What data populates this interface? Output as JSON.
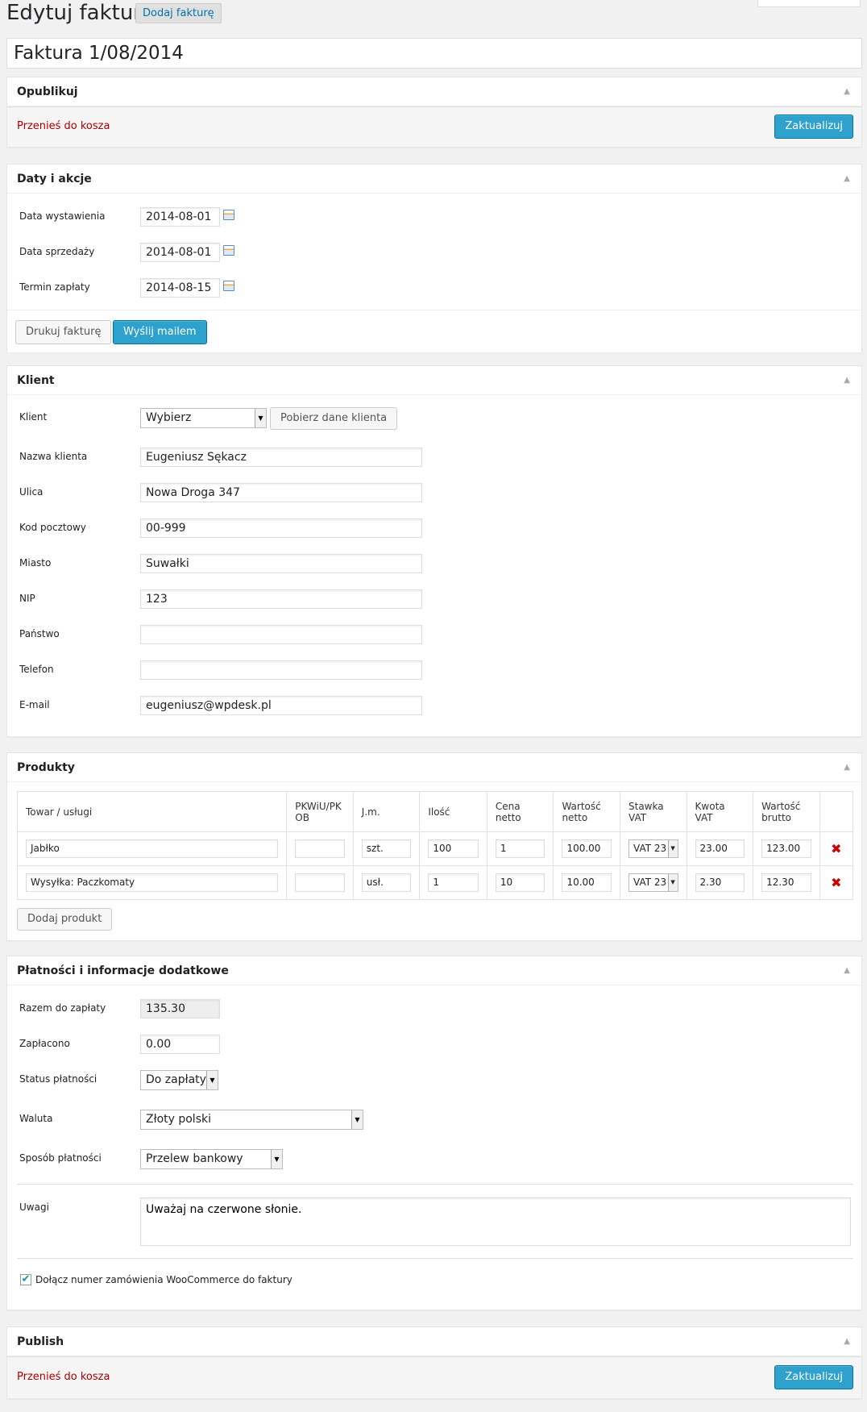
{
  "header": {
    "title": "Edytuj fakturę",
    "add_new": "Dodaj fakturę"
  },
  "post_title": "Faktura 1/08/2014",
  "publish_box": {
    "title": "Opublikuj",
    "trash": "Przenieś do kosza",
    "update": "Zaktualizuj"
  },
  "dates_box": {
    "title": "Daty i akcje",
    "issue_label": "Data wystawienia",
    "issue_value": "2014-08-01",
    "sale_label": "Data sprzedaży",
    "sale_value": "2014-08-01",
    "due_label": "Termin zapłaty",
    "due_value": "2014-08-15",
    "print_button": "Drukuj fakturę",
    "email_button": "Wyślij mailem"
  },
  "client_box": {
    "title": "Klient",
    "client_label": "Klient",
    "client_select": "Wybierz",
    "fetch_button": "Pobierz dane klienta",
    "name_label": "Nazwa klienta",
    "name_value": "Eugeniusz Sękacz",
    "street_label": "Ulica",
    "street_value": "Nowa Droga 347",
    "zip_label": "Kod pocztowy",
    "zip_value": "00-999",
    "city_label": "Miasto",
    "city_value": "Suwałki",
    "nip_label": "NIP",
    "nip_value": "123",
    "country_label": "Państwo",
    "country_value": "",
    "phone_label": "Telefon",
    "phone_value": "",
    "email_label": "E-mail",
    "email_value": "eugeniusz@wpdesk.pl"
  },
  "products_box": {
    "title": "Produkty",
    "columns": [
      "Towar / usługi",
      "PKWiU/PK OB",
      "J.m.",
      "Ilość",
      "Cena netto",
      "Wartość netto",
      "Stawka VAT",
      "Kwota VAT",
      "Wartość brutto"
    ],
    "rows": [
      {
        "name": "Jabłko",
        "pkwiu": "",
        "unit": "szt.",
        "qty": "100",
        "price": "1",
        "net": "100.00",
        "vat_rate": "VAT 23",
        "vat_amount": "23.00",
        "gross": "123.00"
      },
      {
        "name": "Wysyłka: Paczkomaty",
        "pkwiu": "",
        "unit": "usł.",
        "qty": "1",
        "price": "10",
        "net": "10.00",
        "vat_rate": "VAT 23",
        "vat_amount": "2.30",
        "gross": "12.30"
      }
    ],
    "add_button": "Dodaj produkt",
    "delete_symbol": "✖"
  },
  "payment_box": {
    "title": "Płatności i informacje dodatkowe",
    "total_label": "Razem do zapłaty",
    "total_value": "135.30",
    "paid_label": "Zapłacono",
    "paid_value": "0.00",
    "status_label": "Status płatności",
    "status_value": "Do zapłaty",
    "currency_label": "Waluta",
    "currency_value": "Złoty polski",
    "method_label": "Sposób płatności",
    "method_value": "Przelew bankowy",
    "notes_label": "Uwagi",
    "notes_value": "Uważaj na czerwone słonie.",
    "checkbox_label": "Dołącz numer zamówienia WooCommerce do faktury",
    "checkbox_checked": true
  },
  "publish_box2": {
    "title": "Publish",
    "trash": "Przenieś do kosza",
    "update": "Zaktualizuj"
  },
  "colors": {
    "primary": "#2ea2cc",
    "link": "#0073aa",
    "trash": "#aa0000",
    "delete": "#cc0000"
  }
}
